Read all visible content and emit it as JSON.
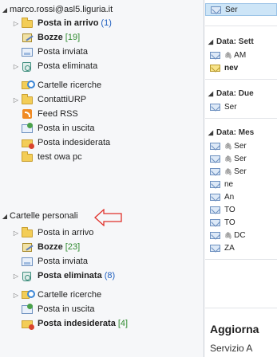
{
  "account": {
    "name": "marco.rossi@asl5.liguria.it"
  },
  "mailbox_folders": [
    {
      "label": "Posta in arrivo",
      "count": "(1)",
      "bold": true,
      "count_color": "blue",
      "icon": "inbox-icon",
      "expander": true
    },
    {
      "label": "Bozze",
      "count": "[19]",
      "bold": true,
      "count_color": "green",
      "icon": "drafts-icon",
      "expander": false
    },
    {
      "label": "Posta inviata",
      "count": "",
      "bold": false,
      "icon": "sent-icon",
      "expander": false
    },
    {
      "label": "Posta eliminata",
      "count": "",
      "bold": false,
      "icon": "deleted-icon",
      "expander": true
    },
    {
      "label": "Cartelle ricerche",
      "count": "",
      "bold": false,
      "icon": "search-folder-icon",
      "expander": false
    },
    {
      "label": "ContattiURP",
      "count": "",
      "bold": false,
      "icon": "folder-icon",
      "expander": true
    },
    {
      "label": "Feed RSS",
      "count": "",
      "bold": false,
      "icon": "rss-icon",
      "expander": false
    },
    {
      "label": "Posta in uscita",
      "count": "",
      "bold": false,
      "icon": "outbox-icon",
      "expander": false
    },
    {
      "label": "Posta indesiderata",
      "count": "",
      "bold": false,
      "icon": "junk-icon",
      "expander": false
    },
    {
      "label": "test owa pc",
      "count": "",
      "bold": false,
      "icon": "folder-icon",
      "expander": false
    }
  ],
  "personal": {
    "label": "Cartelle personali",
    "folders": [
      {
        "label": "Posta in arrivo",
        "count": "",
        "bold": false,
        "icon": "inbox-icon",
        "expander": true
      },
      {
        "label": "Bozze",
        "count": "[23]",
        "bold": true,
        "count_color": "green",
        "icon": "drafts-icon",
        "expander": false
      },
      {
        "label": "Posta inviata",
        "count": "",
        "bold": false,
        "icon": "sent-icon",
        "expander": false
      },
      {
        "label": "Posta eliminata",
        "count": "(8)",
        "bold": true,
        "count_color": "blue",
        "icon": "deleted-icon",
        "expander": true
      },
      {
        "label": "Cartelle ricerche",
        "count": "",
        "bold": false,
        "icon": "search-folder-icon",
        "expander": true
      },
      {
        "label": "Posta in uscita",
        "count": "",
        "bold": false,
        "icon": "outbox-icon",
        "expander": false
      },
      {
        "label": "Posta indesiderata",
        "count": "[4]",
        "bold": true,
        "count_color": "green",
        "icon": "junk-icon",
        "expander": false
      }
    ]
  },
  "messages": {
    "top_item": "Ser",
    "groups": [
      {
        "label": "Data: Sett",
        "items": [
          {
            "text": "AM",
            "bold": false,
            "attach": true,
            "icon": "reply-envelope-icon"
          },
          {
            "text": "nev",
            "bold": true,
            "attach": false,
            "icon": "unread-envelope-icon"
          }
        ]
      },
      {
        "label": "Data: Due",
        "items": [
          {
            "text": "Ser",
            "bold": false,
            "attach": false,
            "icon": "envelope-icon"
          }
        ]
      },
      {
        "label": "Data: Mes",
        "items": [
          {
            "text": "Ser",
            "bold": false,
            "attach": true,
            "icon": "envelope-icon"
          },
          {
            "text": "Ser",
            "bold": false,
            "attach": true,
            "icon": "envelope-icon"
          },
          {
            "text": "Ser",
            "bold": false,
            "attach": true,
            "icon": "envelope-icon"
          },
          {
            "text": "ne",
            "bold": false,
            "attach": false,
            "icon": "envelope-icon"
          },
          {
            "text": "An",
            "bold": false,
            "attach": false,
            "icon": "envelope-icon"
          },
          {
            "text": "TO",
            "bold": false,
            "attach": false,
            "icon": "envelope-icon"
          },
          {
            "text": "TO",
            "bold": false,
            "attach": false,
            "icon": "envelope-icon"
          },
          {
            "text": "DC",
            "bold": false,
            "attach": true,
            "icon": "envelope-icon"
          },
          {
            "text": "ZA",
            "bold": false,
            "attach": false,
            "icon": "envelope-icon"
          }
        ]
      }
    ]
  },
  "preview": {
    "title": "Aggiorna",
    "subtitle": "Servizio A"
  },
  "colors": {
    "count_blue": "#1f5fbf",
    "count_green": "#2f8a2f",
    "annotation_arrow": "#e0302a",
    "selection": "#cde5f7"
  }
}
